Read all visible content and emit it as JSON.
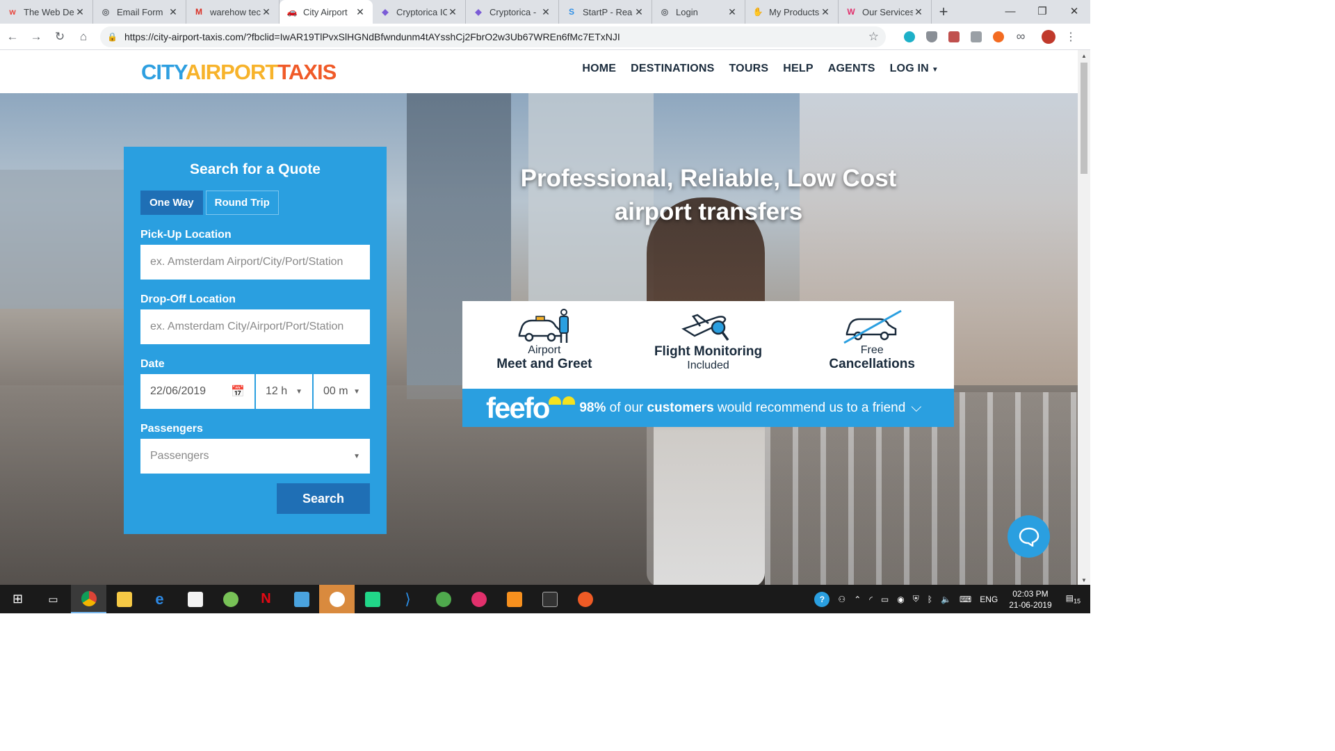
{
  "browser": {
    "tabs": [
      {
        "title": "The Web De",
        "fav_color": "#e8453c",
        "fav_glyph": "w",
        "active": false
      },
      {
        "title": "Email Form",
        "fav_color": "#5f6368",
        "fav_glyph": "◎",
        "active": false
      },
      {
        "title": "warehow tec",
        "fav_color": "#d93025",
        "fav_glyph": "M",
        "active": false
      },
      {
        "title": "City Airport",
        "fav_color": "#1f6fb5",
        "fav_glyph": "🚗",
        "active": true
      },
      {
        "title": "Cryptorica IC",
        "fav_color": "#7b5cd6",
        "fav_glyph": "◆",
        "active": false
      },
      {
        "title": "Cryptorica -",
        "fav_color": "#7b5cd6",
        "fav_glyph": "◆",
        "active": false
      },
      {
        "title": "StartP - Rea",
        "fav_color": "#2e8fe6",
        "fav_glyph": "S",
        "active": false
      },
      {
        "title": "Login",
        "fav_color": "#5f6368",
        "fav_glyph": "◎",
        "active": false
      },
      {
        "title": "My Products",
        "fav_color": "#c8a24a",
        "fav_glyph": "✋",
        "active": false
      },
      {
        "title": "Our Services",
        "fav_color": "#e1306c",
        "fav_glyph": "W",
        "active": false
      }
    ],
    "url": "https://city-airport-taxis.com/?fbclid=IwAR19TlPvxSlHGNdBfwndunm4tAYsshCj2FbrO2w3Ub67WREn6fMc7ETxNJI"
  },
  "site": {
    "logo": {
      "part1": "CITY",
      "part2": "AIRPORT",
      "part3": "TAXIS"
    },
    "nav": [
      "HOME",
      "DESTINATIONS",
      "TOURS",
      "HELP",
      "AGENTS",
      "LOG IN"
    ]
  },
  "quote": {
    "title": "Search for a Quote",
    "tab_one_way": "One Way",
    "tab_round_trip": "Round Trip",
    "pickup_label": "Pick-Up Location",
    "pickup_placeholder": "ex. Amsterdam Airport/City/Port/Station",
    "dropoff_label": "Drop-Off Location",
    "dropoff_placeholder": "ex. Amsterdam City/Airport/Port/Station",
    "date_label": "Date",
    "date_value": "22/06/2019",
    "hour_value": "12 h",
    "minute_value": "00 m",
    "passengers_label": "Passengers",
    "passengers_placeholder": "Passengers",
    "search_label": "Search"
  },
  "hero": {
    "title_line1": "Professional, Reliable, Low Cost",
    "title_line2": "airport transfers"
  },
  "features": [
    {
      "small": "Airport",
      "large": "Meet and Greet",
      "icon": "taxi-driver-icon"
    },
    {
      "large": "Flight Monitoring",
      "small": "Included",
      "icon": "plane-search-icon"
    },
    {
      "small": "Free",
      "large": "Cancellations",
      "icon": "car-cancel-icon"
    }
  ],
  "feefo": {
    "brand": "feefo",
    "pct": "98%",
    "text_a": " of our ",
    "text_b": "customers",
    "text_c": " would recommend us to a friend"
  },
  "taskbar": {
    "lang": "ENG",
    "time": "02:03 PM",
    "date": "21-06-2019",
    "notif_count": "15"
  },
  "colors": {
    "brand_blue": "#2a9fe0",
    "dark_blue": "#1f6fb5",
    "feefo_yellow": "#f4e21f"
  }
}
